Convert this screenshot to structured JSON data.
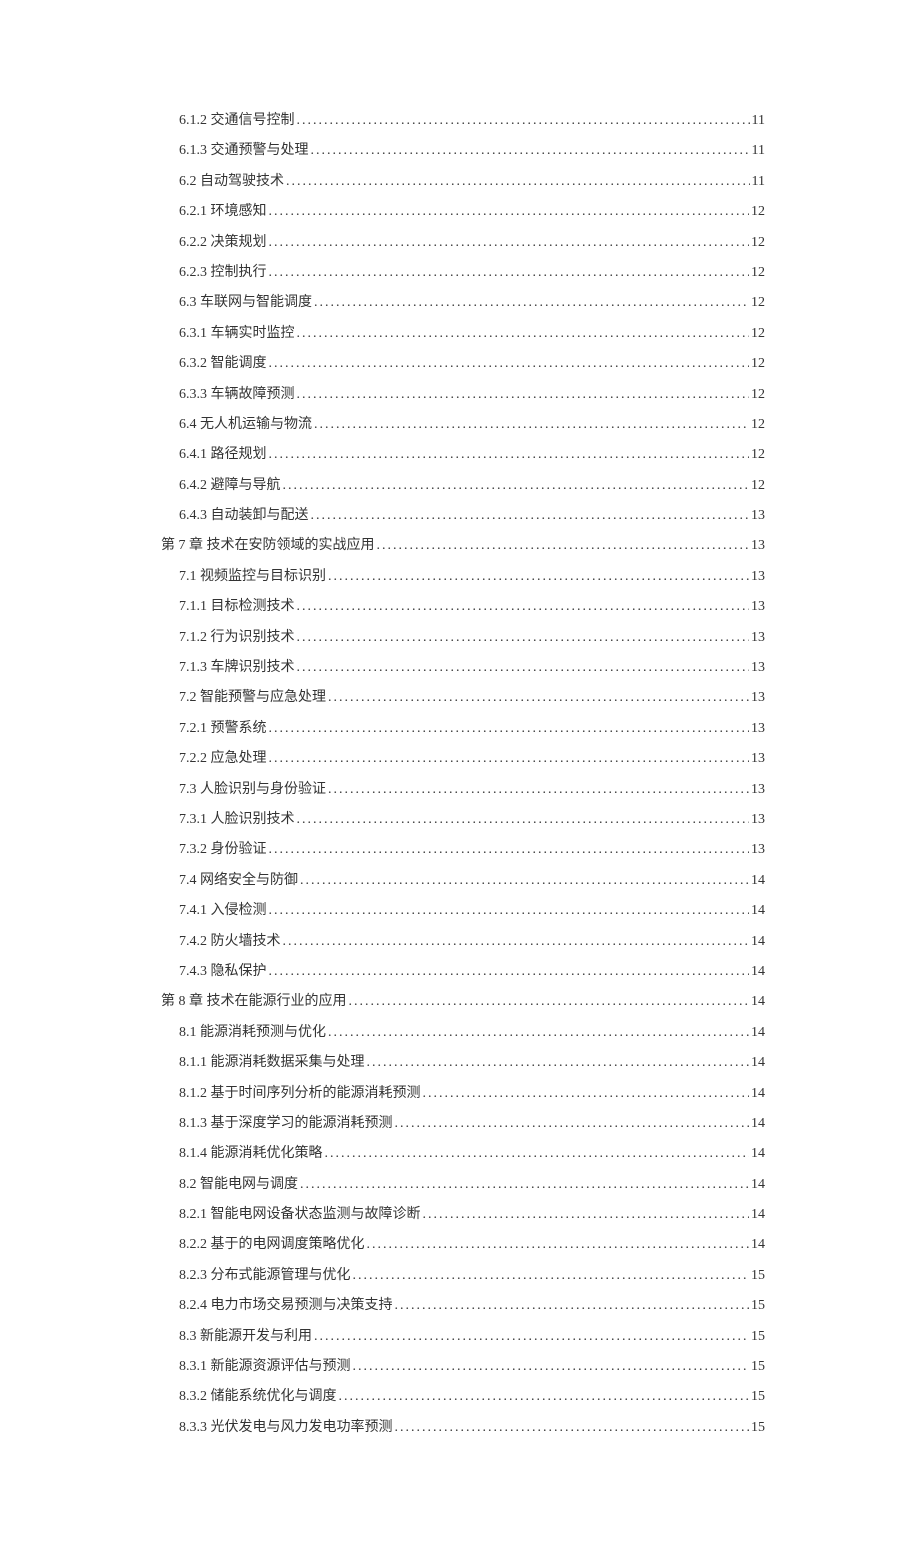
{
  "toc": [
    {
      "level": 2,
      "indent": "",
      "title": "6.1.2 交通信号控制",
      "page": "11"
    },
    {
      "level": 2,
      "indent": "",
      "title": "6.1.3 交通预警与处理",
      "page": "11"
    },
    {
      "level": 1,
      "indent": "",
      "title": "6.2 自动驾驶技术",
      "page": "11"
    },
    {
      "level": 2,
      "indent": "",
      "title": "6.2.1 环境感知",
      "page": "12"
    },
    {
      "level": 2,
      "indent": "",
      "title": "6.2.2 决策规划",
      "page": "12"
    },
    {
      "level": 2,
      "indent": "",
      "title": "6.2.3 控制执行",
      "page": "12"
    },
    {
      "level": 1,
      "indent": "",
      "title": "6.3 车联网与智能调度",
      "page": "12"
    },
    {
      "level": 2,
      "indent": "",
      "title": "6.3.1 车辆实时监控",
      "page": "12"
    },
    {
      "level": 2,
      "indent": "",
      "title": "6.3.2 智能调度",
      "page": "12"
    },
    {
      "level": 2,
      "indent": "",
      "title": "6.3.3 车辆故障预测",
      "page": "12"
    },
    {
      "level": 1,
      "indent": "",
      "title": "6.4 无人机运输与物流",
      "page": "12"
    },
    {
      "level": 2,
      "indent": "",
      "title": "6.4.1 路径规划",
      "page": "12"
    },
    {
      "level": 2,
      "indent": "",
      "title": "6.4.2 避障与导航",
      "page": "12"
    },
    {
      "level": 2,
      "indent": "",
      "title": "6.4.3 自动装卸与配送",
      "page": "13"
    },
    {
      "level": 0,
      "indent": "",
      "title": "第 7 章 技术在安防领域的实战应用",
      "page": "13"
    },
    {
      "level": 1,
      "indent": "",
      "title": "7.1 视频监控与目标识别",
      "page": "13"
    },
    {
      "level": 2,
      "indent": "",
      "title": "7.1.1 目标检测技术",
      "page": "13"
    },
    {
      "level": 2,
      "indent": "",
      "title": "7.1.2 行为识别技术",
      "page": "13"
    },
    {
      "level": 2,
      "indent": "",
      "title": "7.1.3 车牌识别技术",
      "page": "13"
    },
    {
      "level": 1,
      "indent": "",
      "title": "7.2 智能预警与应急处理",
      "page": "13"
    },
    {
      "level": 2,
      "indent": "",
      "title": "7.2.1 预警系统",
      "page": "13"
    },
    {
      "level": 2,
      "indent": "",
      "title": "7.2.2 应急处理",
      "page": "13"
    },
    {
      "level": 1,
      "indent": "",
      "title": "7.3 人脸识别与身份验证",
      "page": "13"
    },
    {
      "level": 2,
      "indent": "",
      "title": "7.3.1 人脸识别技术",
      "page": "13"
    },
    {
      "level": 2,
      "indent": "",
      "title": "7.3.2 身份验证",
      "page": "13"
    },
    {
      "level": 1,
      "indent": "",
      "title": "7.4 网络安全与防御",
      "page": "14"
    },
    {
      "level": 2,
      "indent": "",
      "title": "7.4.1 入侵检测",
      "page": "14"
    },
    {
      "level": 2,
      "indent": "",
      "title": "7.4.2 防火墙技术",
      "page": "14"
    },
    {
      "level": 2,
      "indent": "",
      "title": "7.4.3 隐私保护",
      "page": "14"
    },
    {
      "level": 0,
      "indent": "",
      "title": "第 8 章 技术在能源行业的应用",
      "page": "14"
    },
    {
      "level": 1,
      "indent": "",
      "title": "8.1 能源消耗预测与优化",
      "page": "14"
    },
    {
      "level": 2,
      "indent": "",
      "title": "8.1.1 能源消耗数据采集与处理",
      "page": "14"
    },
    {
      "level": 2,
      "indent": "",
      "title": "8.1.2 基于时间序列分析的能源消耗预测",
      "page": "14"
    },
    {
      "level": 2,
      "indent": "",
      "title": "8.1.3 基于深度学习的能源消耗预测",
      "page": "14"
    },
    {
      "level": 2,
      "indent": "",
      "title": "8.1.4 能源消耗优化策略",
      "page": "14"
    },
    {
      "level": 1,
      "indent": "",
      "title": "8.2 智能电网与调度",
      "page": "14"
    },
    {
      "level": 2,
      "indent": "",
      "title": "8.2.1 智能电网设备状态监测与故障诊断",
      "page": "14"
    },
    {
      "level": 2,
      "indent": "",
      "title": "8.2.2 基于的电网调度策略优化",
      "page": "14"
    },
    {
      "level": 2,
      "indent": "",
      "title": "8.2.3 分布式能源管理与优化",
      "page": "15"
    },
    {
      "level": 2,
      "indent": "",
      "title": "8.2.4 电力市场交易预测与决策支持",
      "page": "15"
    },
    {
      "level": 1,
      "indent": "",
      "title": "8.3 新能源开发与利用",
      "page": "15"
    },
    {
      "level": 2,
      "indent": "",
      "title": "8.3.1 新能源资源评估与预测",
      "page": "15"
    },
    {
      "level": 2,
      "indent": "",
      "title": "8.3.2 储能系统优化与调度",
      "page": "15"
    },
    {
      "level": 2,
      "indent": "",
      "title": "8.3.3 光伏发电与风力发电功率预测",
      "page": "15"
    }
  ]
}
